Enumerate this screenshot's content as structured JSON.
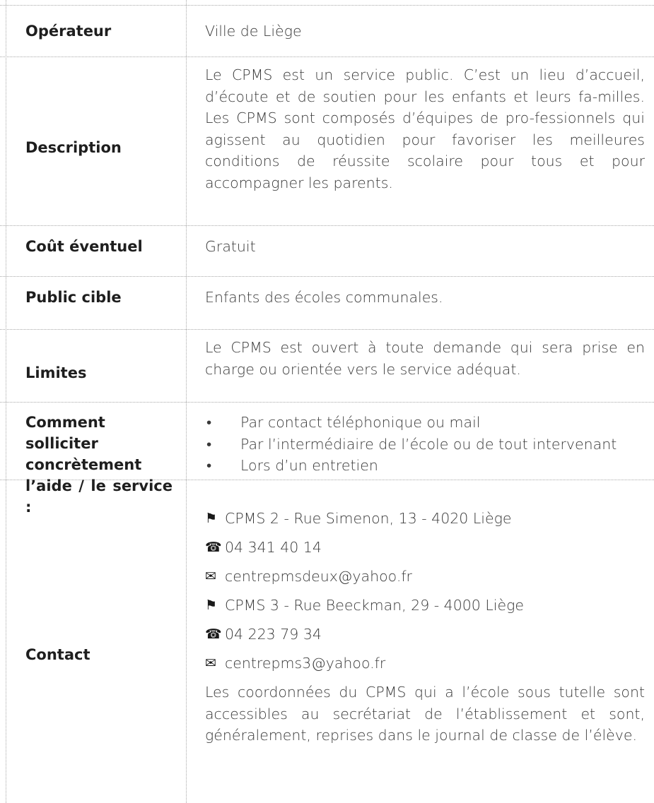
{
  "rows": {
    "operateur": {
      "label": "Opérateur",
      "value": "Ville de Liège"
    },
    "description": {
      "label": "Description",
      "value": "Le CPMS est un service public. C’est un lieu d’accueil, d’écoute et de soutien pour les enfants et leurs fa-milles. Les CPMS sont composés d’équipes de pro-fessionnels qui agissent au quotidien pour favoriser les meilleures conditions de réussite scolaire pour tous et pour accompagner les parents."
    },
    "cout": {
      "label": "Coût éventuel",
      "value": "Gratuit"
    },
    "public": {
      "label": "Public cible",
      "value": "Enfants des écoles communales."
    },
    "limites": {
      "label": "Limites",
      "value": "Le CPMS est ouvert à toute demande qui sera prise en charge ou orientée vers le service adéquat."
    },
    "comment": {
      "label": "Comment solliciter concrètement l’aide / le service :",
      "items": [
        "Par contact téléphonique ou mail",
        "Par l’intermédiaire de l’école ou de tout intervenant",
        "Lors d’un entretien"
      ]
    },
    "contact": {
      "label": "Contact",
      "lines": [
        {
          "icon": "flag-icon",
          "text": "CPMS 2 - Rue Simenon, 13 - 4020 Liège"
        },
        {
          "icon": "phone-icon",
          "text": "04 341 40 14"
        },
        {
          "icon": "envelope-icon",
          "text": "centrepmsdeux@yahoo.fr"
        },
        {
          "icon": "flag-icon",
          "text": "CPMS 3 - Rue Beeckman, 29 - 4000 Liège"
        },
        {
          "icon": "phone-icon",
          "text": "04 223 79 34"
        },
        {
          "icon": "envelope-icon",
          "text": "centrepms3@yahoo.fr"
        }
      ],
      "note": "Les coordonnées du CPMS qui a l’école sous tutelle sont accessibles au secrétariat de l’établissement et sont, généralement, reprises dans le journal de classe de l’élève."
    }
  }
}
